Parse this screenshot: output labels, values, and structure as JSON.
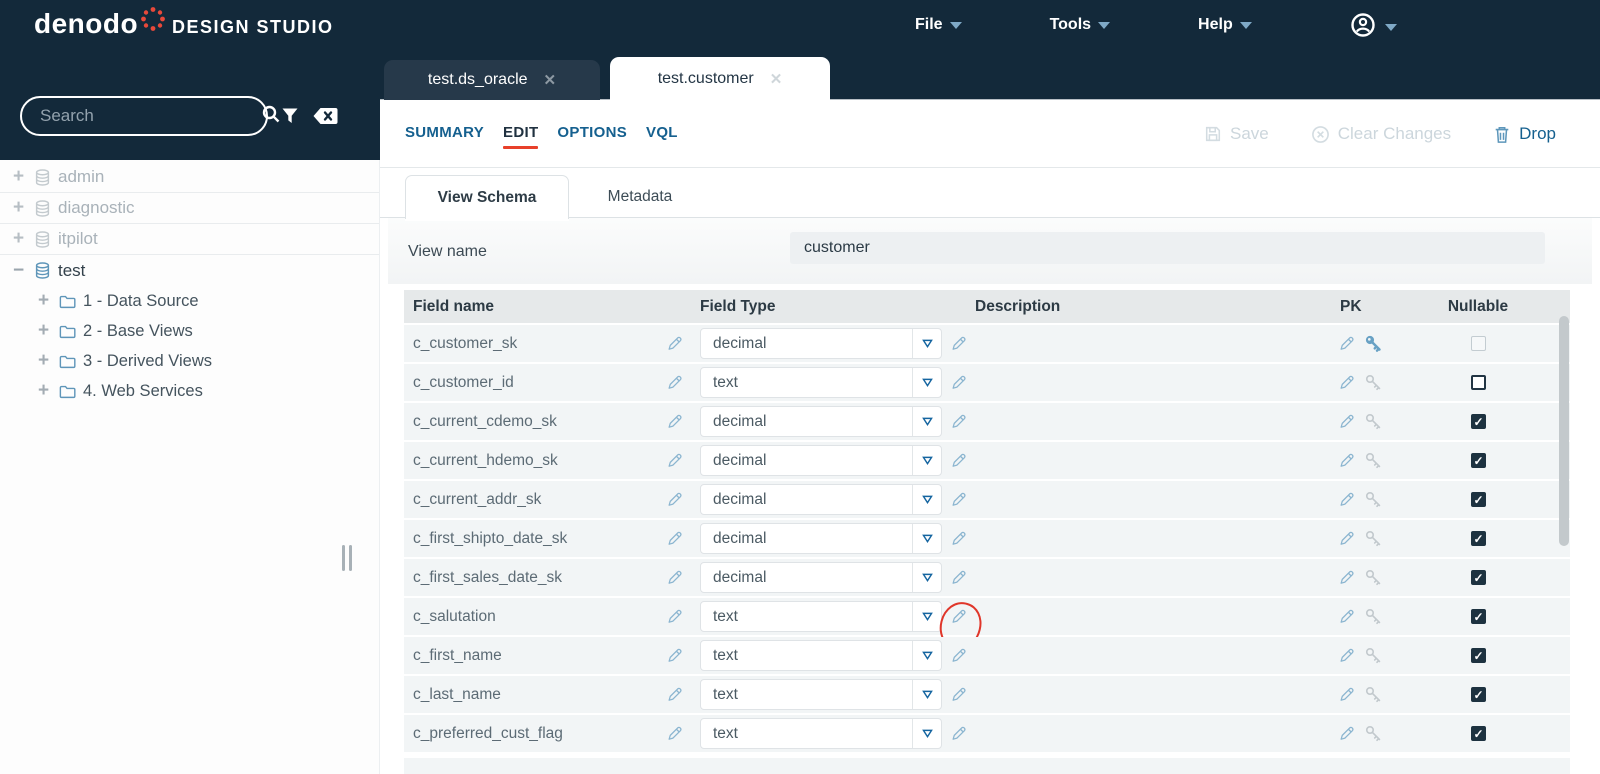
{
  "topbar": {
    "brand": "denodo",
    "product": "DESIGN STUDIO",
    "menus": [
      "File",
      "Tools",
      "Help"
    ]
  },
  "sidebar": {
    "search_placeholder": "Search",
    "tree": [
      {
        "label": "admin",
        "expanded": false,
        "dimmed": true,
        "children": []
      },
      {
        "label": "diagnostic",
        "expanded": false,
        "dimmed": true,
        "children": []
      },
      {
        "label": "itpilot",
        "expanded": false,
        "dimmed": true,
        "children": []
      },
      {
        "label": "test",
        "expanded": true,
        "dimmed": false,
        "children": [
          "1 - Data Source",
          "2 - Base Views",
          "3 - Derived Views",
          "4. Web Services"
        ]
      }
    ]
  },
  "tabs": [
    {
      "label": "test.ds_oracle",
      "close": "✕",
      "active": false
    },
    {
      "label": "test.customer",
      "close": "✕",
      "active": true
    }
  ],
  "subnav": {
    "items": [
      "SUMMARY",
      "EDIT",
      "OPTIONS",
      "VQL"
    ],
    "active": "EDIT"
  },
  "actions": {
    "save": "Save",
    "clear": "Clear Changes",
    "drop": "Drop"
  },
  "panel_tabs": [
    {
      "label": "View Schema",
      "active": true
    },
    {
      "label": "Metadata",
      "active": false
    }
  ],
  "view_name": {
    "label": "View name",
    "value": "customer"
  },
  "schema_table": {
    "headers": [
      "Field name",
      "Field Type",
      "Description",
      "PK",
      "Nullable"
    ],
    "rows": [
      {
        "field": "c_customer_sk",
        "type": "decimal",
        "pk": true,
        "nullable": false
      },
      {
        "field": "c_customer_id",
        "type": "text",
        "pk": false,
        "nullable": false
      },
      {
        "field": "c_current_cdemo_sk",
        "type": "decimal",
        "pk": false,
        "nullable": true
      },
      {
        "field": "c_current_hdemo_sk",
        "type": "decimal",
        "pk": false,
        "nullable": true
      },
      {
        "field": "c_current_addr_sk",
        "type": "decimal",
        "pk": false,
        "nullable": true
      },
      {
        "field": "c_first_shipto_date_sk",
        "type": "decimal",
        "pk": false,
        "nullable": true
      },
      {
        "field": "c_first_sales_date_sk",
        "type": "decimal",
        "pk": false,
        "nullable": true
      },
      {
        "field": "c_salutation",
        "type": "text",
        "pk": false,
        "nullable": true,
        "annotated": true
      },
      {
        "field": "c_first_name",
        "type": "text",
        "pk": false,
        "nullable": true
      },
      {
        "field": "c_last_name",
        "type": "text",
        "pk": false,
        "nullable": true
      },
      {
        "field": "c_preferred_cust_flag",
        "type": "text",
        "pk": false,
        "nullable": true
      }
    ]
  },
  "colors": {
    "navy": "#13293a",
    "accent_blue": "#15608f",
    "icon_blue": "#8bb5d0",
    "key_blue": "#68a1c4",
    "red_accent": "#e8402a",
    "annotation_red": "#e0362a",
    "row_bg": "#f2f5f6",
    "header_bg": "#e6e9ea",
    "logo_red": "#e8493a"
  }
}
